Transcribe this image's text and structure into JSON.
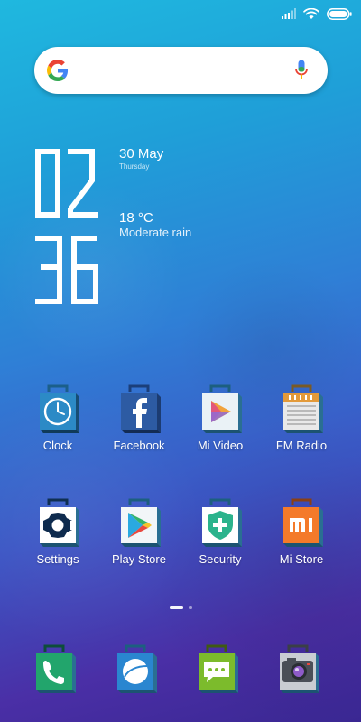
{
  "status_bar": {
    "icons": [
      "signal-icon",
      "wifi-icon",
      "battery-icon"
    ]
  },
  "search": {
    "logo": "google-g-logo",
    "mic": "microphone-icon"
  },
  "widget": {
    "time_hours": "02",
    "time_minutes": "36",
    "date": "30 May",
    "weekday": "Thursday",
    "temperature": "18 °C",
    "condition": "Moderate rain"
  },
  "apps": [
    {
      "label": "Clock",
      "icon": "clock-icon"
    },
    {
      "label": "Facebook",
      "icon": "facebook-icon"
    },
    {
      "label": "Mi Video",
      "icon": "mi-video-icon"
    },
    {
      "label": "FM Radio",
      "icon": "fm-radio-icon"
    },
    {
      "label": "Settings",
      "icon": "settings-icon"
    },
    {
      "label": "Play Store",
      "icon": "play-store-icon"
    },
    {
      "label": "Security",
      "icon": "security-icon"
    },
    {
      "label": "Mi Store",
      "icon": "mi-store-icon"
    }
  ],
  "page_indicator": {
    "pages": 2,
    "current": 1
  },
  "dock": [
    {
      "icon": "phone-icon"
    },
    {
      "icon": "messaging-icon"
    },
    {
      "icon": "android-messages-icon"
    },
    {
      "icon": "camera-icon"
    }
  ],
  "colors": {
    "background_top": "#1fb8df",
    "background_bottom": "#3a2793",
    "text": "#ffffff"
  }
}
